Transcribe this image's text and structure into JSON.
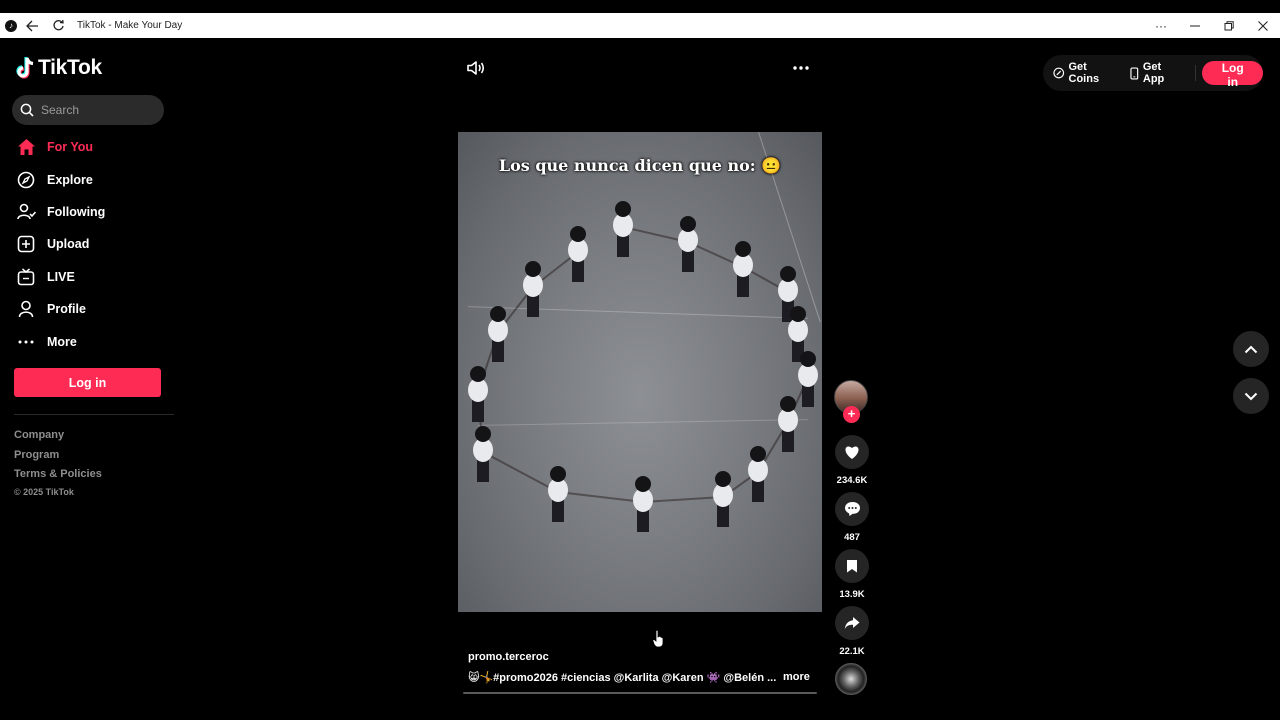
{
  "window": {
    "title": "TikTok - Make Your Day"
  },
  "sidebar": {
    "brand": "TikTok",
    "search_placeholder": "Search",
    "items": [
      {
        "label": "For You",
        "icon": "home-icon",
        "active": true
      },
      {
        "label": "Explore",
        "icon": "compass-icon",
        "active": false
      },
      {
        "label": "Following",
        "icon": "following-icon",
        "active": false
      },
      {
        "label": "Upload",
        "icon": "upload-icon",
        "active": false
      },
      {
        "label": "LIVE",
        "icon": "live-icon",
        "active": false
      },
      {
        "label": "Profile",
        "icon": "profile-icon",
        "active": false
      },
      {
        "label": "More",
        "icon": "more-dots-icon",
        "active": false
      }
    ],
    "login_label": "Log in",
    "footer": {
      "links": [
        "Company",
        "Program",
        "Terms & Policies"
      ],
      "copyright": "© 2025 TikTok"
    }
  },
  "top_actions": {
    "get_coins": "Get Coins",
    "get_app": "Get App",
    "login": "Log in"
  },
  "video": {
    "overlay_caption": "Los que nunca dicen que no: 😐",
    "author": "promo.terceroc",
    "description": "😸🤸#promo2026  #ciencias  @Karlita  @Karen 👾  @Belén ...",
    "more_label": "more"
  },
  "actions": {
    "likes": "234.6K",
    "comments": "487",
    "saves": "13.9K",
    "shares": "22.1K"
  },
  "colors": {
    "accent": "#fe2c55",
    "background": "#000000",
    "button_bg": "#252525"
  }
}
